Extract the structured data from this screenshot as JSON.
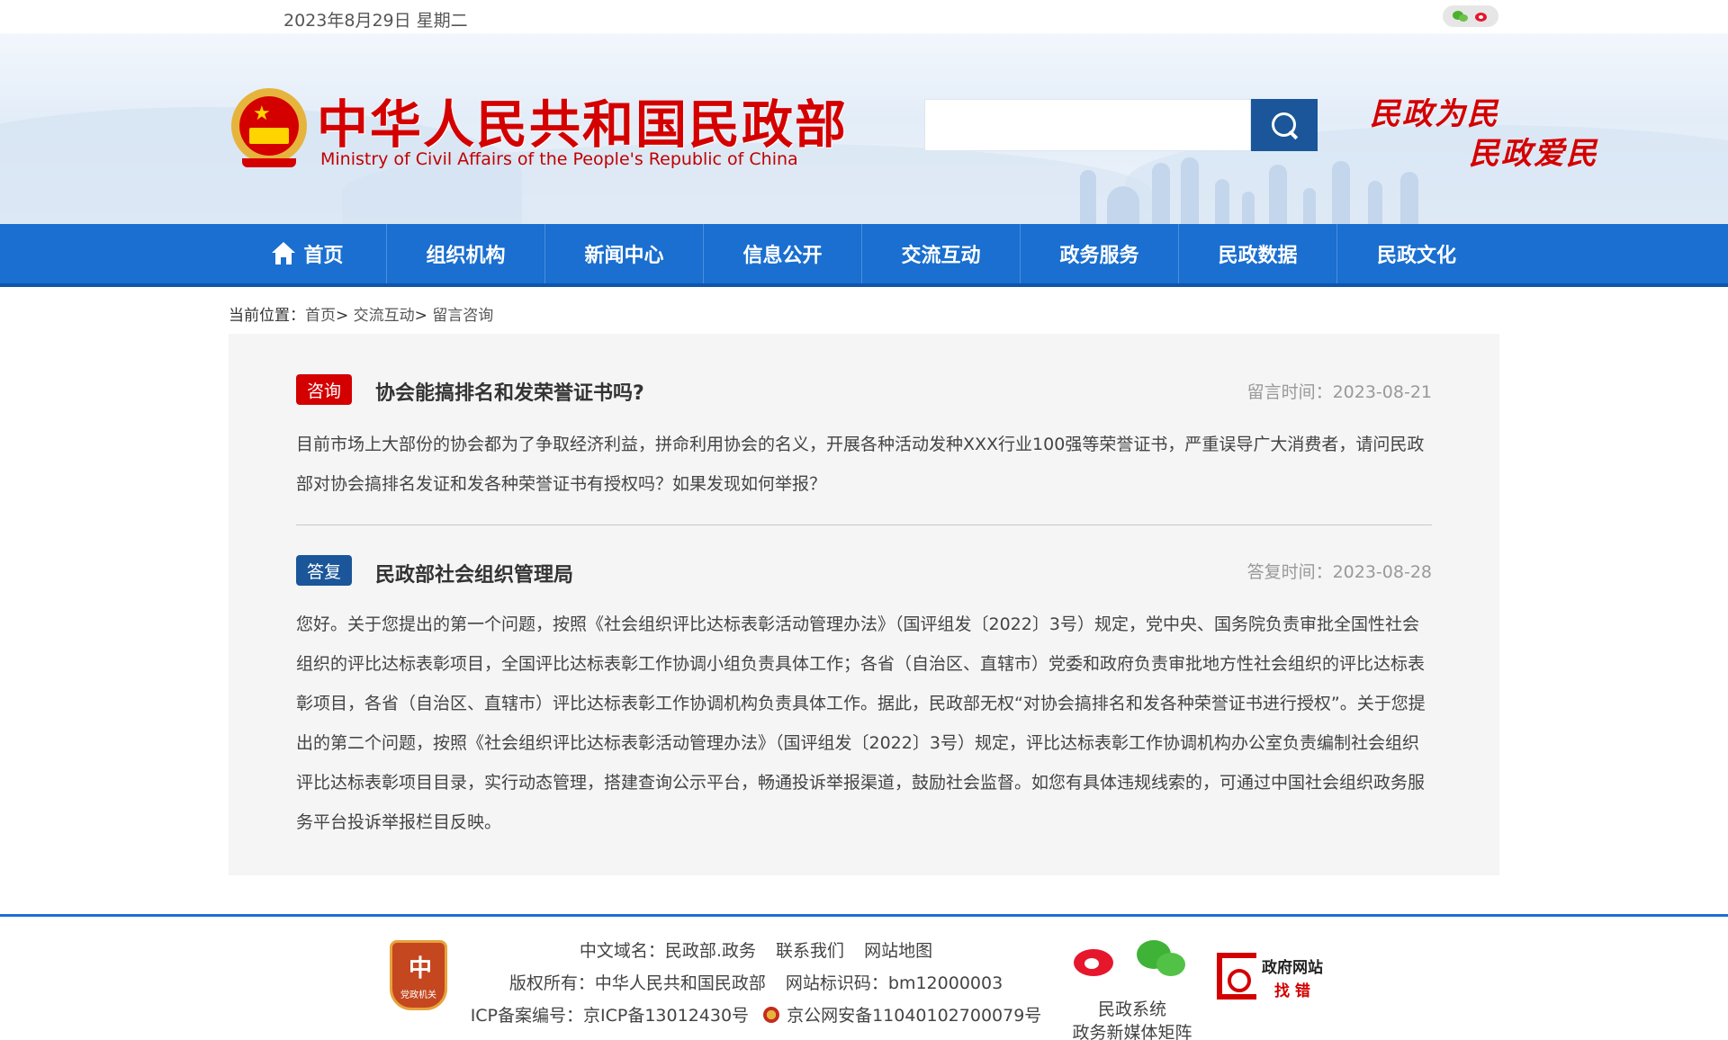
{
  "topbar": {
    "date": "2023年8月29日 星期二"
  },
  "header": {
    "title": "中华人民共和国民政部",
    "subtitle": "Ministry of Civil Affairs of the People's Republic of China",
    "slogan_line1": "民政为民",
    "slogan_line2": "民政爱民",
    "search": {
      "value": "",
      "placeholder": ""
    }
  },
  "nav": {
    "items": [
      {
        "label": "首页"
      },
      {
        "label": "组织机构"
      },
      {
        "label": "新闻中心"
      },
      {
        "label": "信息公开"
      },
      {
        "label": "交流互动"
      },
      {
        "label": "政务服务"
      },
      {
        "label": "民政数据"
      },
      {
        "label": "民政文化"
      }
    ]
  },
  "breadcrumb": {
    "prefix": "当前位置：",
    "items": [
      "首页",
      "交流互动",
      "留言咨询"
    ],
    "sep": ">"
  },
  "question": {
    "tag": "咨询",
    "title": "协会能搞排名和发荣誉证书吗?",
    "time": "留言时间：2023-08-21",
    "body": "目前市场上大部份的协会都为了争取经济利益，拼命利用协会的名义，开展各种活动发种XXX行业100强等荣誉证书，严重误导广大消费者，请问民政部对协会搞排名发证和发各种荣誉证书有授权吗？如果发现如何举报？"
  },
  "answer": {
    "tag": "答复",
    "title": "民政部社会组织管理局",
    "time": "答复时间：2023-08-28",
    "body": "您好。关于您提出的第一个问题，按照《社会组织评比达标表彰活动管理办法》（国评组发〔2022〕3号）规定，党中央、国务院负责审批全国性社会组织的评比达标表彰项目，全国评比达标表彰工作协调小组负责具体工作；各省（自治区、直辖市）党委和政府负责审批地方性社会组织的评比达标表彰项目，各省（自治区、直辖市）评比达标表彰工作协调机构负责具体工作。据此，民政部无权“对协会搞排名和发各种荣誉证书进行授权”。关于您提出的第二个问题，按照《社会组织评比达标表彰活动管理办法》（国评组发〔2022〕3号）规定，评比达标表彰工作协调机构办公室负责编制社会组织评比达标表彰项目目录，实行动态管理，搭建查询公示平台，畅通投诉举报渠道，鼓励社会监督。如您有具体违规线索的，可通过中国社会组织政务服务平台投诉举报栏目反映。"
  },
  "footer": {
    "badge": "党政机关",
    "domain": "中文域名：民政部.政务",
    "contact": "联系我们",
    "sitemap": "网站地图",
    "copyright": "版权所有：中华人民共和国民政部",
    "site_code": "网站标识码：bm12000003",
    "icp": "ICP备案编号：京ICP备13012430号",
    "police": "京公网安备11040102700079号",
    "media_line1": "民政系统",
    "media_line2": "政务新媒体矩阵",
    "jiucuo_line1": "政府网站",
    "jiucuo_line2": "找 错"
  },
  "colors": {
    "brand_red": "#d40000",
    "nav_blue": "#1a6fd0",
    "dark_blue": "#1a5699",
    "panel_bg": "#f5f5f5"
  },
  "icons": [
    "wechat-icon",
    "weibo-icon",
    "national-emblem-icon",
    "search-icon",
    "home-icon",
    "party-badge-icon",
    "police-icon",
    "jiucuo-icon"
  ]
}
